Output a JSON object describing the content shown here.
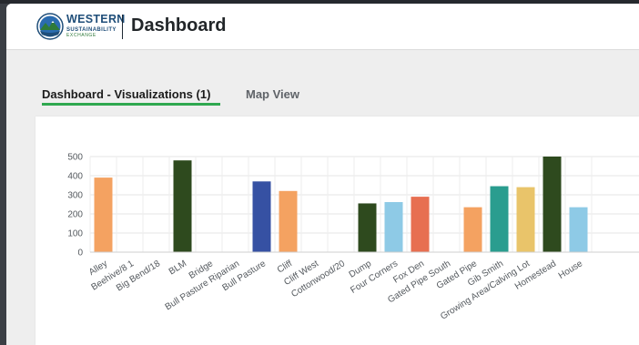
{
  "header": {
    "logo_line1": "WESTERN",
    "logo_line2": "SUSTAINABILITY",
    "logo_line3": "EXCHANGE",
    "title": "Dashboard"
  },
  "tabs": [
    {
      "label": "Dashboard - Visualizations (1)",
      "active": true
    },
    {
      "label": "Map View",
      "active": false
    }
  ],
  "colors": {
    "accent_green": "#2fa84f",
    "brand_blue": "#1f4e79",
    "logo_icon": "globe-mountain-logo"
  },
  "chart_data": {
    "type": "bar",
    "title": "",
    "xlabel": "",
    "ylabel": "",
    "ylim": [
      0,
      500
    ],
    "yticks": [
      0,
      100,
      200,
      300,
      400,
      500
    ],
    "grid": true,
    "categories": [
      "Alley",
      "Beehive/8 1",
      "Big Bend/18",
      "BLM",
      "Bridge",
      "Bull Pasture Riparian",
      "Bull Pasture",
      "Cliff",
      "Cliff West",
      "Cottonwood/20",
      "Dump",
      "Four Corners",
      "Fox Den",
      "Gated Pipe South",
      "Gated Pipe",
      "Gib Smith",
      "Growing Area/Calving Lot",
      "Homestead",
      "House"
    ],
    "values": [
      390,
      0,
      0,
      480,
      0,
      0,
      370,
      320,
      0,
      0,
      255,
      262,
      290,
      0,
      235,
      345,
      340,
      500,
      235
    ],
    "bar_colors": [
      "#f4a261",
      "#f4a261",
      "#f4a261",
      "#2e4a1e",
      "#2e4a1e",
      "#2e4a1e",
      "#3651a3",
      "#f4a261",
      "#f4a261",
      "#f4a261",
      "#2e4a1e",
      "#8ecae6",
      "#e76f51",
      "#e76f51",
      "#f4a261",
      "#2a9d8f",
      "#e9c46a",
      "#2e4a1e",
      "#8ecae6"
    ]
  }
}
